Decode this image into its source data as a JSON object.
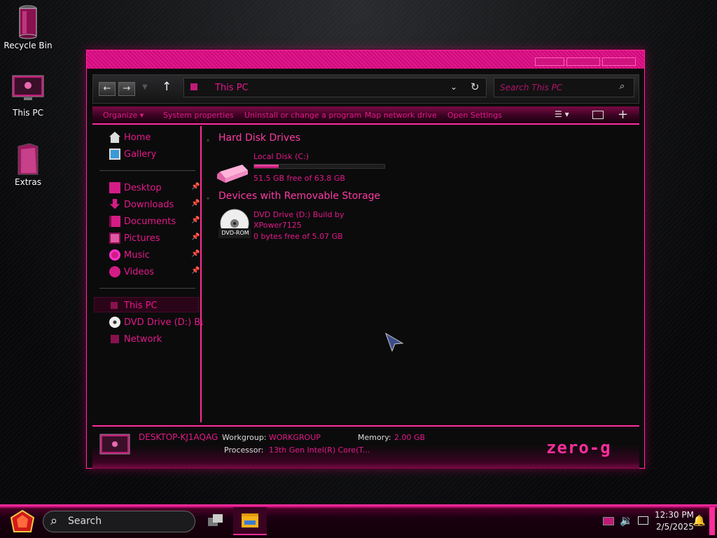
{
  "desktop": {
    "icons": [
      {
        "label": "Recycle Bin",
        "icon": "recycle-bin-icon"
      },
      {
        "label": "This PC",
        "icon": "monitor-icon"
      },
      {
        "label": "Extras",
        "icon": "folder-icon"
      }
    ]
  },
  "window": {
    "address": "This PC",
    "search_placeholder": "Search This PC",
    "commands": {
      "organize": "Organize",
      "system_properties": "System properties",
      "uninstall": "Uninstall or change a program",
      "map_drive": "Map network drive",
      "open_settings": "Open Settings"
    },
    "nav": {
      "home": "Home",
      "gallery": "Gallery",
      "desktop": "Desktop",
      "downloads": "Downloads",
      "documents": "Documents",
      "pictures": "Pictures",
      "music": "Music",
      "videos": "Videos",
      "this_pc": "This PC",
      "dvd": "DVD Drive (D:) Buil",
      "network": "Network"
    },
    "groups": {
      "hdd": "Hard Disk Drives",
      "removable": "Devices with Removable Storage"
    },
    "drives": {
      "c": {
        "name": "Local Disk (C:)",
        "free": "51.5 GB free of 63.8 GB",
        "used_fraction": 0.19
      },
      "d": {
        "name_line1": "DVD Drive (D:) Build by",
        "name_line2": "XPower7125",
        "free": "0 bytes free of 5.07 GB",
        "badge": "DVD-ROM"
      }
    },
    "details": {
      "computer": "DESKTOP-KJ1AQAG",
      "workgroup_label": "Workgroup:",
      "workgroup": "WORKGROUP",
      "memory_label": "Memory:",
      "memory": "2.00 GB",
      "processor_label": "Processor:",
      "processor": "13th Gen Intel(R) Core(T...",
      "brand": "zero-g"
    }
  },
  "taskbar": {
    "search": "Search",
    "time": "12:30 PM",
    "date": "2/5/2025"
  },
  "colors": {
    "accent": "#ff2d9b",
    "text": "#e4198a",
    "background": "#0b0b0c"
  }
}
